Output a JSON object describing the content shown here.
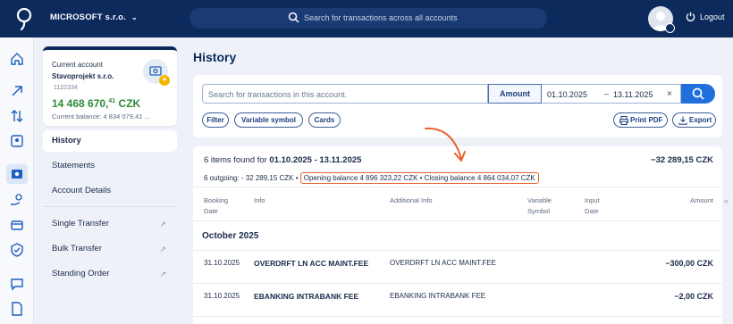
{
  "header": {
    "company": "MICROSOFT s.r.o.",
    "search_placeholder": "Search for transactions across all accounts",
    "logout_label": "Logout",
    "icons": [
      "brand-logo-icon",
      "chevron-down-icon",
      "search-icon",
      "user-avatar-icon",
      "power-icon"
    ]
  },
  "rail": {
    "icons": [
      "home-icon",
      "arrow-up-right-icon",
      "transfer-arrows-icon",
      "id-card-icon",
      "account-icon",
      "hand-coin-icon",
      "cards-icon",
      "shield-icon",
      "chat-icon",
      "document-icon"
    ]
  },
  "account_card": {
    "label": "Current account",
    "name": "Stavoprojekt s.r.o.",
    "number": "1122334",
    "balance_main": "14 468 670,",
    "balance_decimals": "41",
    "balance_currency": " CZK",
    "current_balance": "Current balance: 4 834 079,41 ..."
  },
  "nav": {
    "history": "History",
    "statements": "Statements",
    "account_details": "Account Details",
    "single_transfer": "Single Transfer",
    "bulk_transfer": "Bulk Transfer",
    "standing_order": "Standing Order"
  },
  "page": {
    "title": "History"
  },
  "filters": {
    "search_placeholder": "Search for transactions in this account.",
    "amount_label": "Amount",
    "date_from": "01.10.2025",
    "date_dash": "–",
    "date_to": "13.11.2025",
    "clear": "×",
    "chips": [
      "Filter",
      "Variable symbol",
      "Cards"
    ],
    "print_label": "Print PDF",
    "export_label": "Export"
  },
  "summary": {
    "found_prefix": "6 items found for ",
    "found_range": "01.10.2025 - 13.11.2025",
    "total": "−32 289,15 CZK",
    "outgoing": "6 outgoing: - 32 289,15 CZK •",
    "balances": "Opening balance 4 896 323,22 CZK • Closing balance 4 864 034,07 CZK"
  },
  "table": {
    "headers": {
      "booking_date": "Booking",
      "booking_date2": "Date",
      "info": "Info",
      "additional": "Additional Info",
      "variable": "Variable",
      "variable2": "Symbol",
      "input_date": "Input",
      "input_date2": "Date",
      "amount": "Amount"
    },
    "month": "October 2025",
    "rows": [
      {
        "date": "31.10.2025",
        "info": "OVERDRFT LN ACC MAINT.FEE",
        "additional": "OVERDRFT LN ACC MAINT.FEE",
        "amount": "−300,00 CZK"
      },
      {
        "date": "31.10.2025",
        "info": "EBANKING INTRABANK FEE",
        "additional": "EBANKING INTRABANK FEE",
        "amount": "−2,00 CZK"
      }
    ]
  },
  "colors": {
    "primary": "#0c2a5c",
    "accent": "#1f6fdc",
    "balance_green": "#2f8a3a",
    "highlight_orange": "#e8622c"
  }
}
